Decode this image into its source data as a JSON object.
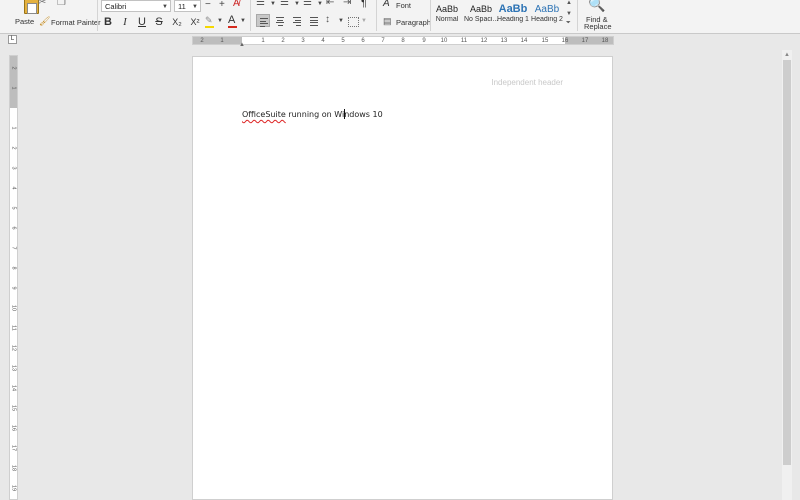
{
  "clipboard": {
    "paste_label": "Paste",
    "format_painter_label": "Format Painter"
  },
  "font": {
    "family": "Calibri",
    "size": "11",
    "bold_glyph": "B",
    "italic_glyph": "I",
    "underline_glyph": "U",
    "strike_glyph": "S",
    "subscript_glyph": "X₂",
    "superscript_glyph": "X²",
    "font_color_glyph": "A",
    "grow_glyph": "+",
    "shrink_glyph": "−",
    "font_dialog_label": "Font"
  },
  "paragraph": {
    "pilcrow_glyph": "¶",
    "paragraph_dialog_label": "Paragraph",
    "active_alignment": "left"
  },
  "styles": [
    {
      "sample": "AaBb",
      "name": "Normal"
    },
    {
      "sample": "AaBb",
      "name": "No Spaci..."
    },
    {
      "sample": "AaBb",
      "name": "Heading 1"
    },
    {
      "sample": "AaBb",
      "name": "Heading 2"
    }
  ],
  "editing": {
    "find_label_1": "Find &",
    "find_label_2": "Replace"
  },
  "ruler": {
    "horizontal_ticks": [
      "2",
      "1",
      "1",
      "2",
      "3",
      "4",
      "5",
      "6",
      "7",
      "8",
      "9",
      "10",
      "11",
      "12",
      "13",
      "14",
      "15",
      "16",
      "17",
      "18"
    ],
    "vertical_ticks": [
      "2",
      "1",
      "1",
      "2",
      "3",
      "4",
      "5",
      "6",
      "7",
      "8",
      "9",
      "10",
      "11",
      "12",
      "13",
      "14",
      "15",
      "16",
      "17",
      "18",
      "19"
    ]
  },
  "document": {
    "header_text": "Independent header",
    "body_before_squiggle": "",
    "squiggle_word": "OfficeSuite",
    "body_mid": " running on Wi",
    "body_after_caret": "ndows 10"
  },
  "colors": {
    "highlight": "#f5d800",
    "font_color": "#d52b1e",
    "ribbon_bg": "#f3f3f3",
    "find_icon": "#2b7cd3"
  }
}
